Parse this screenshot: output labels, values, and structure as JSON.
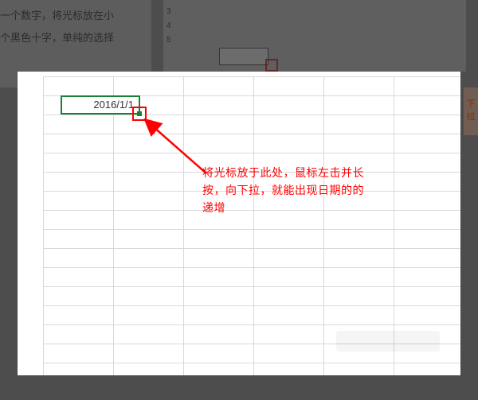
{
  "background": {
    "article_line1": "一个数字，将光标放在小",
    "article_line2": "个黑色十字，单纯的选择",
    "right_strip": "下拉"
  },
  "sheet": {
    "active_cell_value": "2016/1/1"
  },
  "annotation": {
    "text": "将光标放于此处，鼠标左击并长按，向下拉，就能出现日期的的递增"
  }
}
